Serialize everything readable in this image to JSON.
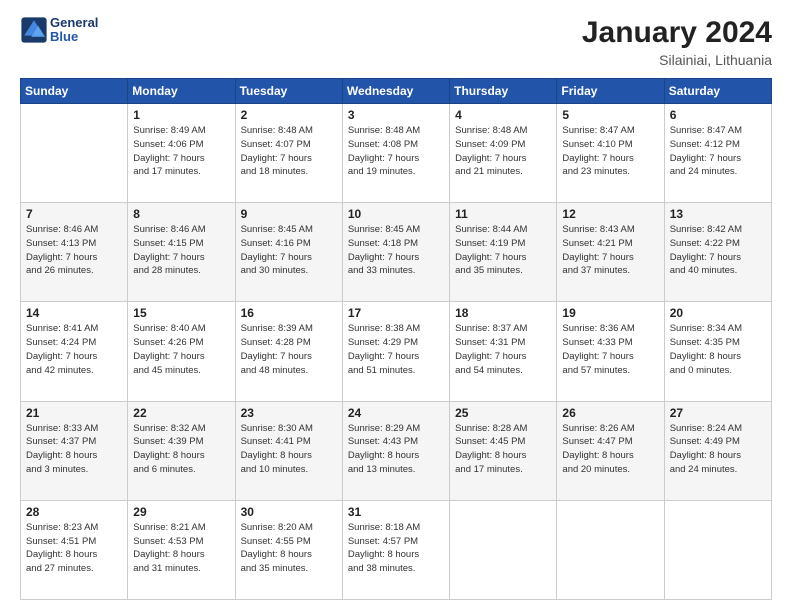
{
  "header": {
    "logo_line1": "General",
    "logo_line2": "Blue",
    "main_title": "January 2024",
    "subtitle": "Silainiai, Lithuania"
  },
  "weekdays": [
    "Sunday",
    "Monday",
    "Tuesday",
    "Wednesday",
    "Thursday",
    "Friday",
    "Saturday"
  ],
  "weeks": [
    [
      {
        "day": "",
        "info": ""
      },
      {
        "day": "1",
        "info": "Sunrise: 8:49 AM\nSunset: 4:06 PM\nDaylight: 7 hours\nand 17 minutes."
      },
      {
        "day": "2",
        "info": "Sunrise: 8:48 AM\nSunset: 4:07 PM\nDaylight: 7 hours\nand 18 minutes."
      },
      {
        "day": "3",
        "info": "Sunrise: 8:48 AM\nSunset: 4:08 PM\nDaylight: 7 hours\nand 19 minutes."
      },
      {
        "day": "4",
        "info": "Sunrise: 8:48 AM\nSunset: 4:09 PM\nDaylight: 7 hours\nand 21 minutes."
      },
      {
        "day": "5",
        "info": "Sunrise: 8:47 AM\nSunset: 4:10 PM\nDaylight: 7 hours\nand 23 minutes."
      },
      {
        "day": "6",
        "info": "Sunrise: 8:47 AM\nSunset: 4:12 PM\nDaylight: 7 hours\nand 24 minutes."
      }
    ],
    [
      {
        "day": "7",
        "info": "Sunrise: 8:46 AM\nSunset: 4:13 PM\nDaylight: 7 hours\nand 26 minutes."
      },
      {
        "day": "8",
        "info": "Sunrise: 8:46 AM\nSunset: 4:15 PM\nDaylight: 7 hours\nand 28 minutes."
      },
      {
        "day": "9",
        "info": "Sunrise: 8:45 AM\nSunset: 4:16 PM\nDaylight: 7 hours\nand 30 minutes."
      },
      {
        "day": "10",
        "info": "Sunrise: 8:45 AM\nSunset: 4:18 PM\nDaylight: 7 hours\nand 33 minutes."
      },
      {
        "day": "11",
        "info": "Sunrise: 8:44 AM\nSunset: 4:19 PM\nDaylight: 7 hours\nand 35 minutes."
      },
      {
        "day": "12",
        "info": "Sunrise: 8:43 AM\nSunset: 4:21 PM\nDaylight: 7 hours\nand 37 minutes."
      },
      {
        "day": "13",
        "info": "Sunrise: 8:42 AM\nSunset: 4:22 PM\nDaylight: 7 hours\nand 40 minutes."
      }
    ],
    [
      {
        "day": "14",
        "info": "Sunrise: 8:41 AM\nSunset: 4:24 PM\nDaylight: 7 hours\nand 42 minutes."
      },
      {
        "day": "15",
        "info": "Sunrise: 8:40 AM\nSunset: 4:26 PM\nDaylight: 7 hours\nand 45 minutes."
      },
      {
        "day": "16",
        "info": "Sunrise: 8:39 AM\nSunset: 4:28 PM\nDaylight: 7 hours\nand 48 minutes."
      },
      {
        "day": "17",
        "info": "Sunrise: 8:38 AM\nSunset: 4:29 PM\nDaylight: 7 hours\nand 51 minutes."
      },
      {
        "day": "18",
        "info": "Sunrise: 8:37 AM\nSunset: 4:31 PM\nDaylight: 7 hours\nand 54 minutes."
      },
      {
        "day": "19",
        "info": "Sunrise: 8:36 AM\nSunset: 4:33 PM\nDaylight: 7 hours\nand 57 minutes."
      },
      {
        "day": "20",
        "info": "Sunrise: 8:34 AM\nSunset: 4:35 PM\nDaylight: 8 hours\nand 0 minutes."
      }
    ],
    [
      {
        "day": "21",
        "info": "Sunrise: 8:33 AM\nSunset: 4:37 PM\nDaylight: 8 hours\nand 3 minutes."
      },
      {
        "day": "22",
        "info": "Sunrise: 8:32 AM\nSunset: 4:39 PM\nDaylight: 8 hours\nand 6 minutes."
      },
      {
        "day": "23",
        "info": "Sunrise: 8:30 AM\nSunset: 4:41 PM\nDaylight: 8 hours\nand 10 minutes."
      },
      {
        "day": "24",
        "info": "Sunrise: 8:29 AM\nSunset: 4:43 PM\nDaylight: 8 hours\nand 13 minutes."
      },
      {
        "day": "25",
        "info": "Sunrise: 8:28 AM\nSunset: 4:45 PM\nDaylight: 8 hours\nand 17 minutes."
      },
      {
        "day": "26",
        "info": "Sunrise: 8:26 AM\nSunset: 4:47 PM\nDaylight: 8 hours\nand 20 minutes."
      },
      {
        "day": "27",
        "info": "Sunrise: 8:24 AM\nSunset: 4:49 PM\nDaylight: 8 hours\nand 24 minutes."
      }
    ],
    [
      {
        "day": "28",
        "info": "Sunrise: 8:23 AM\nSunset: 4:51 PM\nDaylight: 8 hours\nand 27 minutes."
      },
      {
        "day": "29",
        "info": "Sunrise: 8:21 AM\nSunset: 4:53 PM\nDaylight: 8 hours\nand 31 minutes."
      },
      {
        "day": "30",
        "info": "Sunrise: 8:20 AM\nSunset: 4:55 PM\nDaylight: 8 hours\nand 35 minutes."
      },
      {
        "day": "31",
        "info": "Sunrise: 8:18 AM\nSunset: 4:57 PM\nDaylight: 8 hours\nand 38 minutes."
      },
      {
        "day": "",
        "info": ""
      },
      {
        "day": "",
        "info": ""
      },
      {
        "day": "",
        "info": ""
      }
    ]
  ]
}
